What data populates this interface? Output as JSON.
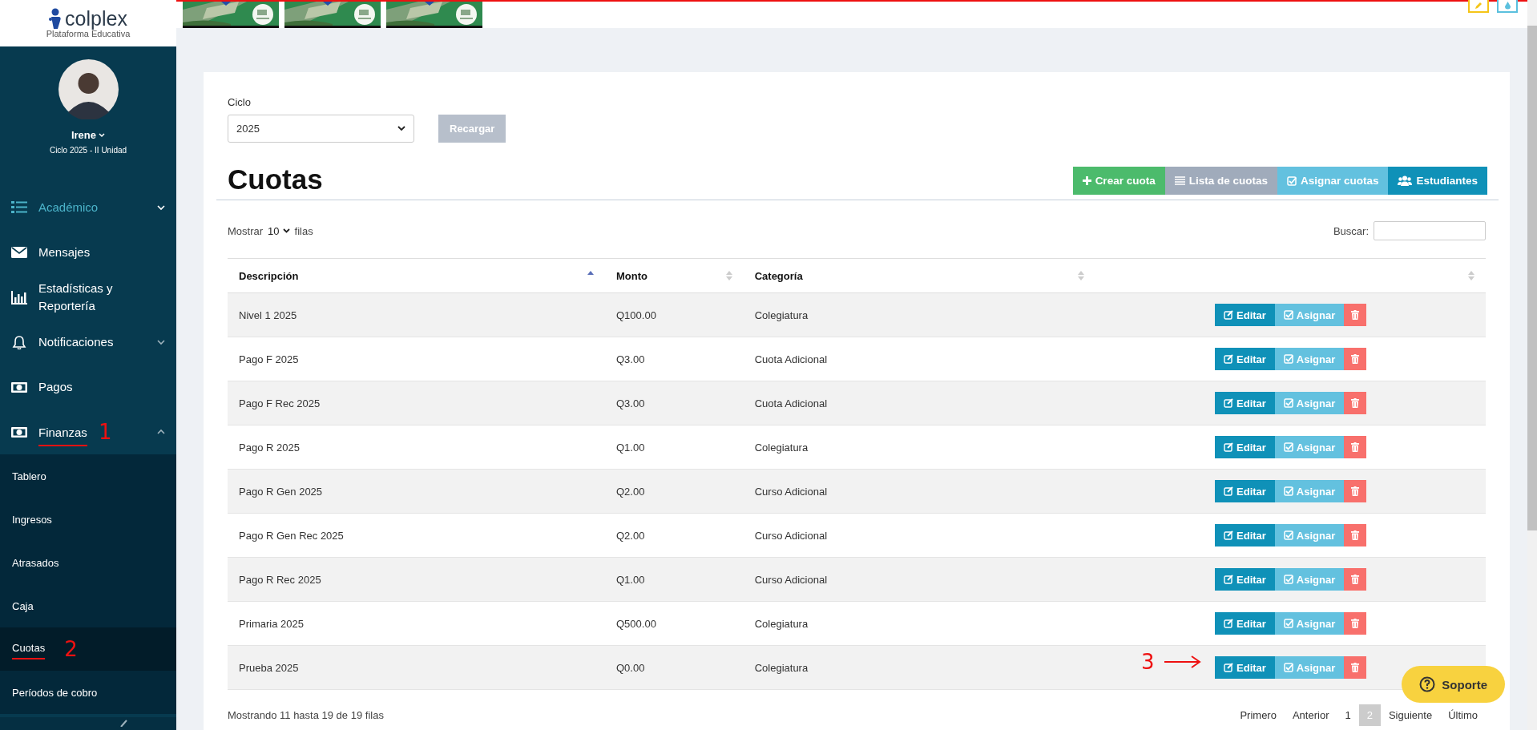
{
  "sidebar": {
    "logo": {
      "name": "colplex",
      "tagline": "Plataforma Educativa"
    },
    "user": {
      "name": "Irene",
      "cycle": "Ciclo 2025 - II Unidad"
    },
    "menu": [
      {
        "label": "Académico",
        "kind": "list",
        "selected": true,
        "expanded": false
      },
      {
        "label": "Mensajes",
        "kind": "mail",
        "selected": false
      },
      {
        "label": "Estadísticas y Reportería",
        "kind": "chart",
        "selected": false
      },
      {
        "label": "Notificaciones",
        "kind": "bell",
        "selected": false,
        "expanded": false
      },
      {
        "label": "Pagos",
        "kind": "money",
        "selected": false
      },
      {
        "label": "Finanzas",
        "kind": "money",
        "selected": false,
        "expanded": true,
        "annotation": "1",
        "children": [
          {
            "label": "Tablero",
            "selected": false
          },
          {
            "label": "Ingresos",
            "selected": false
          },
          {
            "label": "Atrasados",
            "selected": false
          },
          {
            "label": "Caja",
            "selected": false
          },
          {
            "label": "Cuotas",
            "selected": true,
            "annotation": "2"
          },
          {
            "label": "Períodos de cobro",
            "selected": false
          }
        ]
      }
    ]
  },
  "top_actions": [
    {
      "kind": "pencil",
      "color": "#f5c518"
    },
    {
      "kind": "drop",
      "color": "#5bc0de"
    }
  ],
  "filter": {
    "label": "Ciclo",
    "value": "2025"
  },
  "reload_button": {
    "label": "Recargar",
    "disabled": true
  },
  "title": "Cuotas",
  "actions": [
    {
      "label": "Crear cuota",
      "kind": "plus",
      "color": "#4cbb6c"
    },
    {
      "label": "Lista de cuotas",
      "kind": "list",
      "color": "#a0abbb"
    },
    {
      "label": "Asignar cuotas",
      "kind": "check",
      "color": "#63c1df"
    },
    {
      "label": "Estudiantes",
      "kind": "users",
      "color": "#0f91b8"
    }
  ],
  "length": {
    "prefix": "Mostrar",
    "value": "10",
    "suffix": "filas"
  },
  "search": {
    "label": "Buscar:"
  },
  "columns": [
    {
      "label": "Descripción",
      "sorted": true
    },
    {
      "label": "Monto",
      "sorted": false
    },
    {
      "label": "Categoría",
      "sorted": false
    },
    {
      "sorted": false
    }
  ],
  "rows": [
    {
      "description": "Nivel 1 2025",
      "amount": "Q100.00",
      "category": "Colegiatura",
      "edit": "Editar",
      "assign": "Asignar"
    },
    {
      "description": "Pago F 2025",
      "amount": "Q3.00",
      "category": "Cuota Adicional",
      "edit": "Editar",
      "assign": "Asignar"
    },
    {
      "description": "Pago F Rec 2025",
      "amount": "Q3.00",
      "category": "Cuota Adicional",
      "edit": "Editar",
      "assign": "Asignar"
    },
    {
      "description": "Pago R 2025",
      "amount": "Q1.00",
      "category": "Colegiatura",
      "edit": "Editar",
      "assign": "Asignar"
    },
    {
      "description": "Pago R Gen 2025",
      "amount": "Q2.00",
      "category": "Curso Adicional",
      "edit": "Editar",
      "assign": "Asignar"
    },
    {
      "description": "Pago R Gen Rec 2025",
      "amount": "Q2.00",
      "category": "Curso Adicional",
      "edit": "Editar",
      "assign": "Asignar"
    },
    {
      "description": "Pago R Rec 2025",
      "amount": "Q1.00",
      "category": "Curso Adicional",
      "edit": "Editar",
      "assign": "Asignar"
    },
    {
      "description": "Primaria 2025",
      "amount": "Q500.00",
      "category": "Colegiatura",
      "edit": "Editar",
      "assign": "Asignar"
    },
    {
      "description": "Prueba 2025",
      "amount": "Q0.00",
      "category": "Colegiatura",
      "edit": "Editar",
      "assign": "Asignar",
      "annotation": "3"
    }
  ],
  "info": "Mostrando 11 hasta 19 de 19 filas",
  "pagination": [
    {
      "label": "Primero",
      "selected": false
    },
    {
      "label": "Anterior",
      "selected": false
    },
    {
      "label": "1",
      "selected": false
    },
    {
      "label": "2",
      "selected": true
    },
    {
      "label": "Siguiente",
      "selected": false
    },
    {
      "label": "Último",
      "selected": false
    }
  ],
  "support": {
    "label": "Soporte"
  }
}
